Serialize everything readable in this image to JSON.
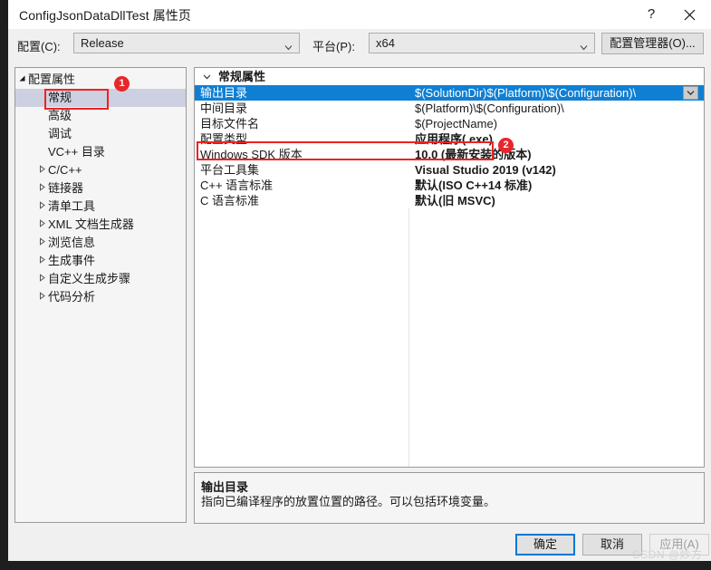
{
  "window": {
    "title": "ConfigJsonDataDllTest 属性页",
    "help_icon": "?",
    "close_icon": "close-icon"
  },
  "config_bar": {
    "configuration_label": "配置(C):",
    "configuration_value": "Release",
    "platform_label": "平台(P):",
    "platform_value": "x64",
    "config_manager_button": "配置管理器(O)..."
  },
  "sidebar": {
    "items": [
      {
        "label": "配置属性",
        "indent": 14,
        "expander": "▲",
        "selected": false
      },
      {
        "label": "常规",
        "indent": 36,
        "expander": "",
        "selected": true
      },
      {
        "label": "高级",
        "indent": 36,
        "expander": "",
        "selected": false
      },
      {
        "label": "调试",
        "indent": 36,
        "expander": "",
        "selected": false
      },
      {
        "label": "VC++ 目录",
        "indent": 36,
        "expander": "",
        "selected": false
      },
      {
        "label": "C/C++",
        "indent": 36,
        "expander": "▷",
        "selected": false
      },
      {
        "label": "链接器",
        "indent": 36,
        "expander": "▷",
        "selected": false
      },
      {
        "label": "清单工具",
        "indent": 36,
        "expander": "▷",
        "selected": false
      },
      {
        "label": "XML 文档生成器",
        "indent": 36,
        "expander": "▷",
        "selected": false
      },
      {
        "label": "浏览信息",
        "indent": 36,
        "expander": "▷",
        "selected": false
      },
      {
        "label": "生成事件",
        "indent": 36,
        "expander": "▷",
        "selected": false
      },
      {
        "label": "自定义生成步骤",
        "indent": 36,
        "expander": "▷",
        "selected": false
      },
      {
        "label": "代码分析",
        "indent": 36,
        "expander": "▷",
        "selected": false
      }
    ]
  },
  "property_grid": {
    "category": "常规属性",
    "category_expander": "⌄",
    "rows": [
      {
        "key": "输出目录",
        "value": "$(SolutionDir)$(Platform)\\$(Configuration)\\",
        "bold": false,
        "selected": true
      },
      {
        "key": "中间目录",
        "value": "$(Platform)\\$(Configuration)\\",
        "bold": false,
        "selected": false
      },
      {
        "key": "目标文件名",
        "value": "$(ProjectName)",
        "bold": false,
        "selected": false
      },
      {
        "key": "配置类型",
        "value": "应用程序(.exe)",
        "bold": true,
        "selected": false
      },
      {
        "key": "Windows SDK 版本",
        "value": "10.0 (最新安装的版本)",
        "bold": true,
        "selected": false
      },
      {
        "key": "平台工具集",
        "value": "Visual Studio 2019 (v142)",
        "bold": true,
        "selected": false
      },
      {
        "key": "C++ 语言标准",
        "value": "默认(ISO C++14 标准)",
        "bold": true,
        "selected": false
      },
      {
        "key": "C 语言标准",
        "value": "默认(旧 MSVC)",
        "bold": true,
        "selected": false
      }
    ]
  },
  "description": {
    "title": "输出目录",
    "text": "指向已编译程序的放置位置的路径。可以包括环境变量。"
  },
  "footer": {
    "ok_label": "确定",
    "cancel_label": "取消",
    "apply_label": "应用(A)"
  },
  "annotations": {
    "badge_1": "1",
    "badge_2": "2",
    "color": "#ee2222"
  },
  "watermark": "CSDN @炒方"
}
